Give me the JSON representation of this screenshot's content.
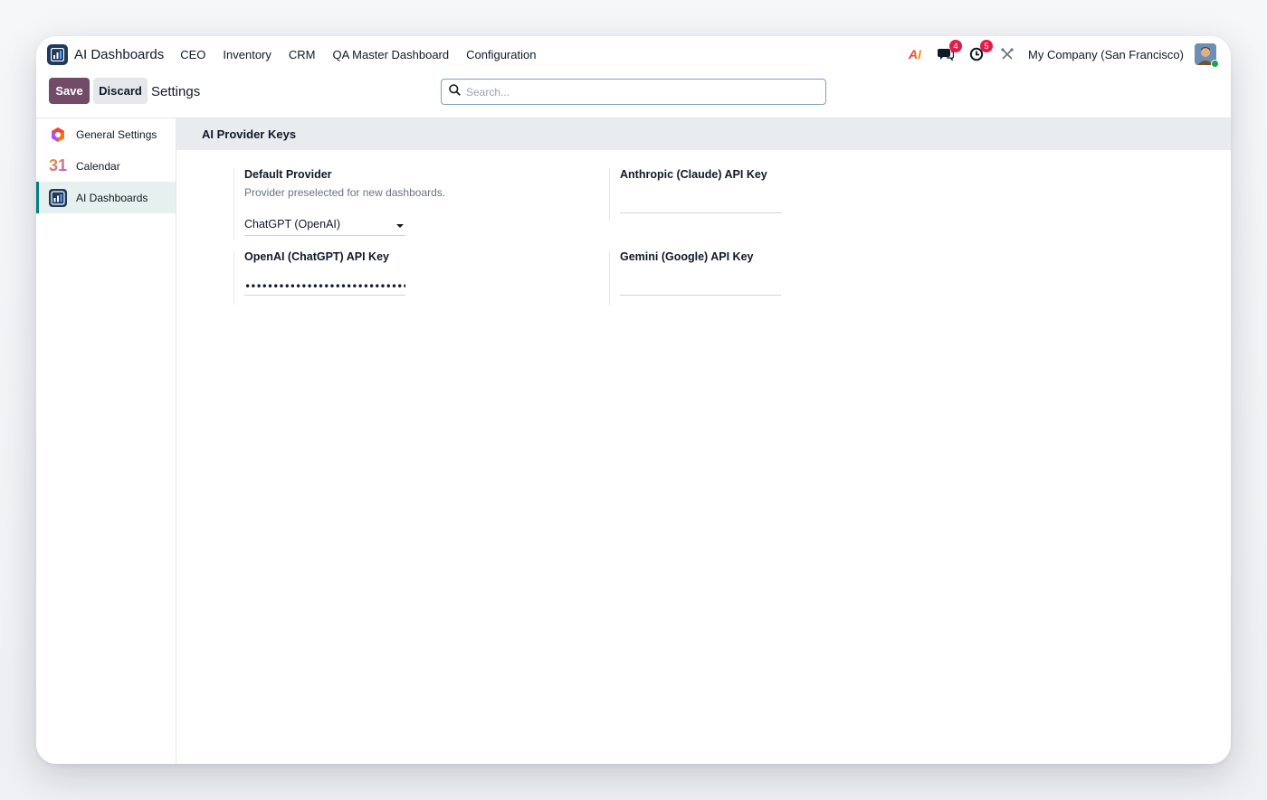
{
  "navbar": {
    "app_title": "AI Dashboards",
    "menu": [
      "CEO",
      "Inventory",
      "CRM",
      "QA Master Dashboard",
      "Configuration"
    ],
    "ai_icon_text": "AI",
    "messages_badge": "4",
    "activities_badge": "5",
    "company": "My Company (San Francisco)"
  },
  "control_panel": {
    "save_label": "Save",
    "discard_label": "Discard",
    "breadcrumb": "Settings",
    "search_placeholder": "Search..."
  },
  "sidebar": {
    "items": [
      {
        "label": "General Settings",
        "icon": "general-settings-icon"
      },
      {
        "label": "Calendar",
        "icon": "calendar-icon",
        "icon_text": "31"
      },
      {
        "label": "AI Dashboards",
        "icon": "ai-dashboards-icon",
        "active": true
      }
    ]
  },
  "main": {
    "section_title": "AI Provider Keys",
    "default_provider": {
      "label": "Default Provider",
      "description": "Provider preselected for new dashboards.",
      "value": "ChatGPT (OpenAI)"
    },
    "anthropic": {
      "label": "Anthropic (Claude) API Key",
      "value": ""
    },
    "openai": {
      "label": "OpenAI (ChatGPT) API Key",
      "value": "••••••••••••••••••••••••••••••••••••"
    },
    "gemini": {
      "label": "Gemini (Google) API Key",
      "value": ""
    }
  },
  "colors": {
    "primary": "#714b67",
    "accent": "#017e84",
    "badge": "#e11d48"
  }
}
